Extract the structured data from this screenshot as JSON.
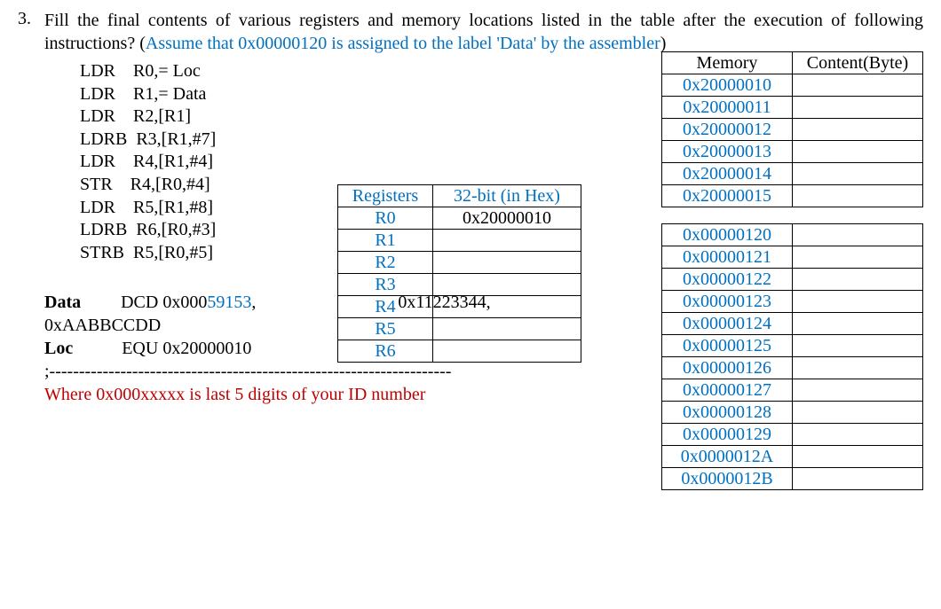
{
  "question_number": "3.",
  "question_text_1": "Fill the final contents of various registers and memory locations listed in the table after the execution of following instructions?  (",
  "question_text_blue": "Assume that 0x00000120 is assigned to the label 'Data' by the assembler",
  "question_text_2": ")",
  "instructions": [
    "LDR    R0,= Loc",
    "LDR    R1,= Data",
    "LDR    R2,[R1]",
    "LDRB  R3,[R1,#7]",
    "LDR    R4,[R1,#4]",
    "STR    R4,[R0,#4]",
    "LDR    R5,[R1,#8]",
    "LDRB  R6,[R0,#3]",
    "STRB  R5,[R0,#5]"
  ],
  "reg_header1": "Registers",
  "reg_header2": "32-bit (in Hex)",
  "registers": [
    {
      "name": "R0",
      "val": "0x20000010"
    },
    {
      "name": "R1",
      "val": ""
    },
    {
      "name": "R2",
      "val": ""
    },
    {
      "name": "R3",
      "val": ""
    },
    {
      "name": "R4",
      "val": ""
    },
    {
      "name": "R5",
      "val": ""
    },
    {
      "name": "R6",
      "val": ""
    }
  ],
  "mem_header1": "Memory",
  "mem_header2": "Content(Byte)",
  "memory_block1": [
    "0x20000010",
    "0x20000011",
    "0x20000012",
    "0x20000013",
    "0x20000014",
    "0x20000015"
  ],
  "memory_block2": [
    "0x00000120",
    "0x00000121",
    "0x00000122",
    "0x00000123",
    "0x00000124",
    "0x00000125",
    "0x00000126",
    "0x00000127",
    "0x00000128",
    "0x00000129",
    "0x0000012A",
    "0x0000012B"
  ],
  "data_label": "Data",
  "data_dcd": "DCD   0x000",
  "data_dcd_blue": "59153",
  "data_dcd_tail": ",",
  "data_val2": "0x11223344,",
  "data_line2": "0xAABBCCDD",
  "loc_label": "Loc",
  "loc_equ": "EQU  0x20000010",
  "sep_line": ";--------------------------------------------------------------------",
  "footnote": "Where 0x000xxxxx is last 5 digits of your ID number"
}
